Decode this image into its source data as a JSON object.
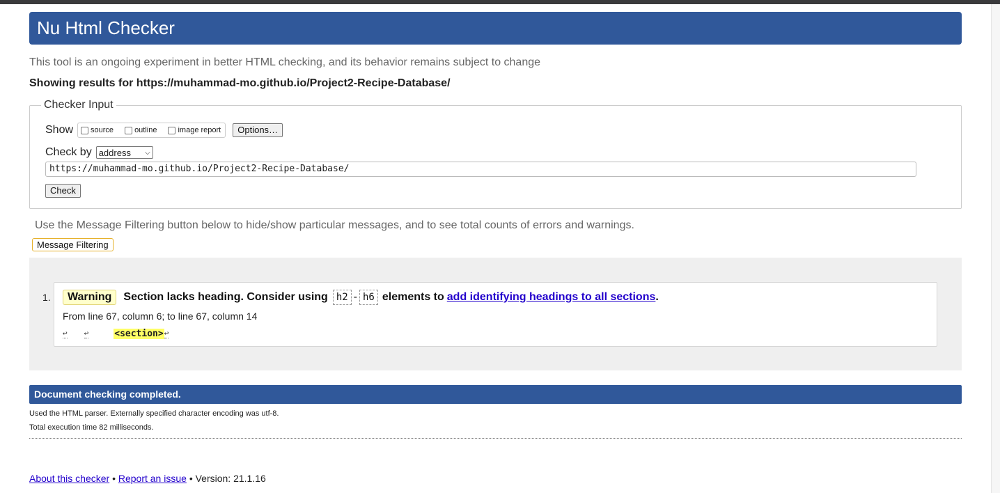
{
  "header": {
    "title": "Nu Html Checker"
  },
  "intro_text": "This tool is an ongoing experiment in better HTML checking, and its behavior remains subject to change",
  "results_for": "Showing results for https://muhammad-mo.github.io/Project2-Recipe-Database/",
  "checker_input": {
    "legend": "Checker Input",
    "show_label": "Show",
    "show_options": [
      {
        "label": "source",
        "checked": false
      },
      {
        "label": "outline",
        "checked": false
      },
      {
        "label": "image report",
        "checked": false
      }
    ],
    "options_button": "Options…",
    "check_by_label": "Check by",
    "check_by_value": "address",
    "url_value": "https://muhammad-mo.github.io/Project2-Recipe-Database/",
    "check_button": "Check"
  },
  "filter": {
    "note": "Use the Message Filtering button below to hide/show particular messages, and to see total counts of errors and warnings.",
    "button": "Message Filtering"
  },
  "messages": [
    {
      "number": "1.",
      "type": "Warning",
      "text_before": "Section lacks heading. Consider using",
      "code_from": "h2",
      "dash": "-",
      "code_to": "h6",
      "text_mid": "elements to",
      "link": "add identifying headings to all sections",
      "text_end": ".",
      "location": "From line 67, column 6; to line 67, column 14",
      "extract_tag": "<section>",
      "lf_glyph": "↩"
    }
  ],
  "completion": {
    "title": "Document checking completed.",
    "parser_note": "Used the HTML parser. Externally specified character encoding was utf-8.",
    "exec_time": "Total execution time 82 milliseconds."
  },
  "footer": {
    "about": "About this checker",
    "sep1": "•",
    "report": "Report an issue",
    "version": "• Version: 21.1.16"
  },
  "colors": {
    "banner": "#30589a",
    "warning_badge": "#ffffcc",
    "highlight": "#ffff66",
    "link": "#2200cc",
    "filter_border": "#e6b12b"
  }
}
